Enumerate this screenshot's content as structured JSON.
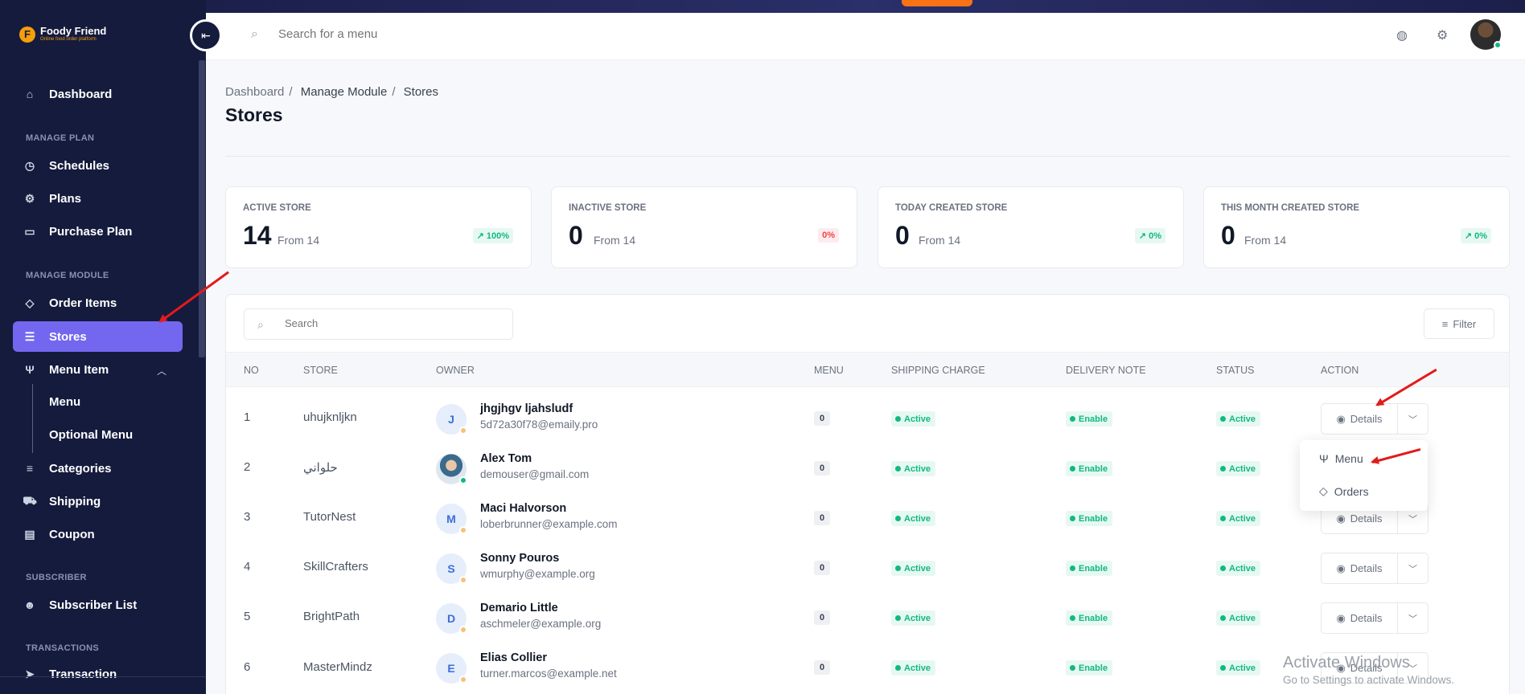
{
  "app": {
    "name": "Foody Friend",
    "tagline": "Online food order platform"
  },
  "sidebar": {
    "dashboard": "Dashboard",
    "sections": [
      "MANAGE PLAN",
      "MANAGE MODULE",
      "SUBSCRIBER",
      "TRANSACTIONS"
    ],
    "items": {
      "schedules": "Schedules",
      "plans": "Plans",
      "purchase_plan": "Purchase Plan",
      "order_items": "Order Items",
      "stores": "Stores",
      "menu_item": "Menu Item",
      "menu": "Menu",
      "optional_menu": "Optional Menu",
      "categories": "Categories",
      "shipping": "Shipping",
      "coupon": "Coupon",
      "subscriber_list": "Subscriber List",
      "transaction": "Transaction"
    }
  },
  "header": {
    "search_placeholder": "Search for a menu"
  },
  "breadcrumb": [
    "Dashboard",
    "Manage Module",
    "Stores"
  ],
  "page_title": "Stores",
  "stats": [
    {
      "label": "ACTIVE STORE",
      "value": "14",
      "from": "From 14",
      "pct": "100%",
      "trend": "up"
    },
    {
      "label": "INACTIVE STORE",
      "value": "0",
      "from": "From 14",
      "pct": "0%",
      "trend": "down"
    },
    {
      "label": "TODAY CREATED STORE",
      "value": "0",
      "from": "From 14",
      "pct": "0%",
      "trend": "up"
    },
    {
      "label": "THIS MONTH CREATED STORE",
      "value": "0",
      "from": "From 14",
      "pct": "0%",
      "trend": "up"
    }
  ],
  "table": {
    "search_placeholder": "Search",
    "filter_label": "Filter",
    "columns": [
      "NO",
      "STORE",
      "OWNER",
      "MENU",
      "SHIPPING CHARGE",
      "DELIVERY NOTE",
      "STATUS",
      "ACTION"
    ],
    "rows": [
      {
        "no": "1",
        "store": "uhujknljkn",
        "initial": "J",
        "owner": "jhgjhgv ljahsludf",
        "email": "5d72a30f78@emaily.pro",
        "menu": "0",
        "shipping": "Active",
        "delivery": "Enable",
        "status": "Active",
        "action": "Details"
      },
      {
        "no": "2",
        "store": "حلواني",
        "initial": "",
        "owner": "Alex Tom",
        "email": "demouser@gmail.com",
        "menu": "0",
        "shipping": "Active",
        "delivery": "Enable",
        "status": "Active",
        "action": "Details"
      },
      {
        "no": "3",
        "store": "TutorNest",
        "initial": "M",
        "owner": "Maci Halvorson",
        "email": "loberbrunner@example.com",
        "menu": "0",
        "shipping": "Active",
        "delivery": "Enable",
        "status": "Active",
        "action": "Details"
      },
      {
        "no": "4",
        "store": "SkillCrafters",
        "initial": "S",
        "owner": "Sonny Pouros",
        "email": "wmurphy@example.org",
        "menu": "0",
        "shipping": "Active",
        "delivery": "Enable",
        "status": "Active",
        "action": "Details"
      },
      {
        "no": "5",
        "store": "BrightPath",
        "initial": "D",
        "owner": "Demario Little",
        "email": "aschmeler@example.org",
        "menu": "0",
        "shipping": "Active",
        "delivery": "Enable",
        "status": "Active",
        "action": "Details"
      },
      {
        "no": "6",
        "store": "MasterMindz",
        "initial": "E",
        "owner": "Elias Collier",
        "email": "turner.marcos@example.net",
        "menu": "0",
        "shipping": "Active",
        "delivery": "Enable",
        "status": "Active",
        "action": "Details"
      }
    ]
  },
  "dropdown": {
    "options": [
      "Menu",
      "Orders"
    ]
  },
  "watermark": {
    "line1": "Activate Windows",
    "line2": "Go to Settings to activate Windows."
  },
  "colors": {
    "sidebar_bg": "#151b3d",
    "accent": "#7367f0",
    "success": "#10b981",
    "danger": "#ef4444",
    "annotation": "#e21b1b"
  }
}
